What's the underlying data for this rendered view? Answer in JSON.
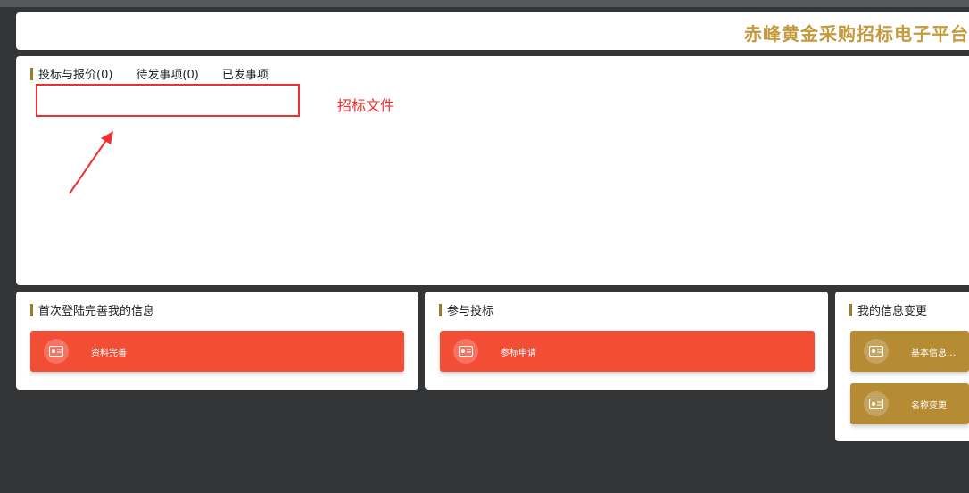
{
  "header": {
    "title": "赤峰黄金采购招标电子平台"
  },
  "tabs": [
    {
      "label": "投标与报价(0)"
    },
    {
      "label": "待发事项(0)"
    },
    {
      "label": "已发事项"
    }
  ],
  "annotation": {
    "label": "招标文件",
    "color": "#f03030"
  },
  "cards": {
    "first_login": {
      "title": "首次登陆完善我的信息",
      "button": "资料完善"
    },
    "bidding": {
      "title": "参与投标",
      "button": "参标申请"
    },
    "info_change": {
      "title": "我的信息变更",
      "buttons": [
        "基本信息…",
        "名称变更"
      ]
    }
  },
  "colors": {
    "accent_gold": "#c49a3c",
    "button_red": "#f24d35",
    "button_gold": "#b58b33",
    "background": "#333537"
  },
  "icons": {
    "button_icon": "id-card-icon"
  }
}
